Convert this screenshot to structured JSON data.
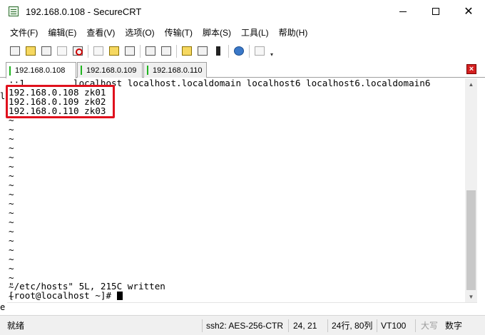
{
  "window": {
    "title": "192.168.0.108 - SecureCRT"
  },
  "menu": [
    "文件(F)",
    "编辑(E)",
    "查看(V)",
    "选项(O)",
    "传输(T)",
    "脚本(S)",
    "工具(L)",
    "帮助(H)"
  ],
  "toolbar": {
    "icons": [
      "connect-icon",
      "quick-connect-icon",
      "connect-tab-icon",
      "reconnect-icon",
      "disconnect-icon",
      "copy-icon",
      "paste-icon",
      "find-icon",
      "print-icon",
      "print-setup-icon",
      "settings-icon",
      "keymap-icon",
      "keygen-icon",
      "help-icon",
      "sftp-icon"
    ]
  },
  "tabs": [
    {
      "label": "192.168.0.108",
      "active": true
    },
    {
      "label": "192.168.0.109",
      "active": false
    },
    {
      "label": "192.168.0.110",
      "active": false
    }
  ],
  "terminal": {
    "lines": [
      "::1         localhost localhost.localdomain localhost6 localhost6.localdomain6",
      "192.168.0.108 zk01",
      "192.168.0.109 zk02",
      "192.168.0.110 zk03",
      "~",
      "~",
      "~",
      "~",
      "~",
      "~",
      "~",
      "~",
      "~",
      "~",
      "~",
      "~",
      "~",
      "~",
      "~",
      "~",
      "~",
      "~",
      "~",
      "~",
      "~",
      "\"/etc/hosts\" 5L, 215C written",
      "[root@localhost ~]# "
    ],
    "left_edge": {
      "top": "l",
      "bottom": "e"
    }
  },
  "status": {
    "ready": "就绪",
    "cipher": "ssh2: AES-256-CTR",
    "position": "24,  21",
    "size": "24行, 80列",
    "emulation": "VT100",
    "caps": "大写",
    "num": "数字"
  },
  "colors": {
    "highlight": "#e0111d",
    "tab_marker": "#1fb41f"
  }
}
